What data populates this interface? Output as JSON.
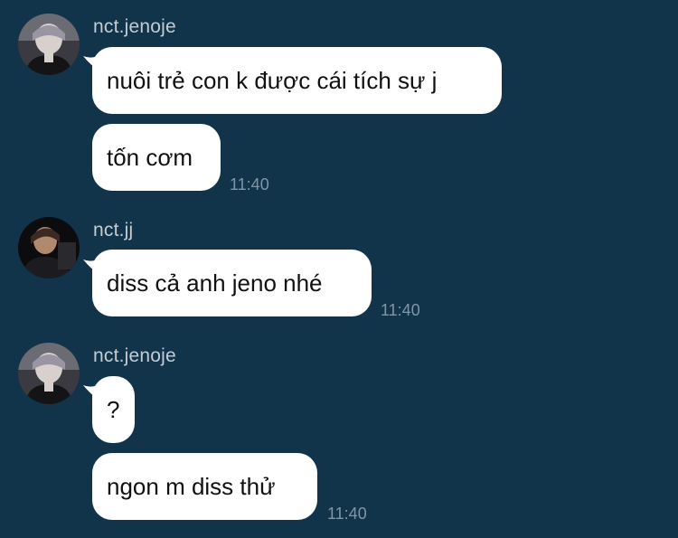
{
  "messages": [
    {
      "username": "nct.jenoje",
      "avatar": "avatar-jenoje",
      "bubbles": [
        "nuôi trẻ con k được cái tích sự j",
        "tốn cơm"
      ],
      "time": "11:40"
    },
    {
      "username": "nct.jj",
      "avatar": "avatar-jj",
      "bubbles": [
        "diss cả anh jeno nhé"
      ],
      "time": "11:40"
    },
    {
      "username": "nct.jenoje",
      "avatar": "avatar-jenoje",
      "bubbles": [
        "?",
        "ngon m diss thử"
      ],
      "time": "11:40"
    }
  ],
  "colors": {
    "background": "#12344a",
    "bubble": "#ffffff",
    "username": "#c3ccd3",
    "timestamp": "#7e96a6"
  }
}
